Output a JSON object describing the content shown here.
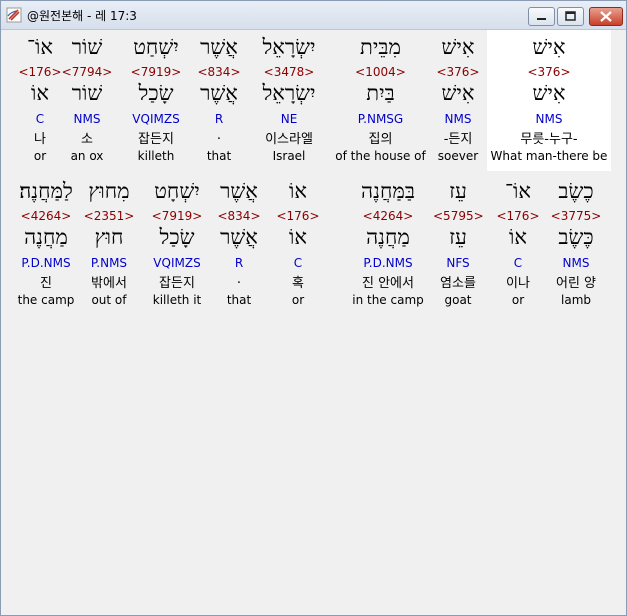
{
  "window": {
    "title": "@원전본해 - 레 17:3",
    "app_icon": "scroll-icon",
    "controls": [
      "minimize-icon",
      "maximize-icon",
      "close-icon"
    ]
  },
  "rows": [
    {
      "words": [
        {
          "heb": "אוֹ־",
          "code": "<176>",
          "lemma": "אוֹ",
          "morph": "C",
          "kor": "나",
          "eng": "or"
        },
        {
          "heb": "שׁוֹר",
          "code": "<7794>",
          "lemma": "שׁוֹר",
          "morph": "NMS",
          "kor": "소",
          "eng": "an ox"
        },
        {
          "heb": "יִשְׁחַט",
          "code": "<7919>",
          "lemma": "שָׂכַל",
          "morph": "VQIMZS",
          "kor": "잡든지",
          "eng": "killeth"
        },
        {
          "heb": "אֲשֶׁר",
          "code": "<834>",
          "lemma": "אֲשֶׁר",
          "morph": "R",
          "kor": ".",
          "eng": "that"
        },
        {
          "heb": "יִשְׂרָאֵל",
          "code": "<3478>",
          "lemma": "יִשְׂרָאֵל",
          "morph": "NE",
          "kor": "이스라엘",
          "eng": "Israel"
        },
        {
          "heb": "מִבֵּית",
          "code": "<1004>",
          "lemma": "בַּיִת",
          "morph": "P.NMSG",
          "kor": "집의",
          "eng": "of the house of"
        },
        {
          "heb": "אִישׁ",
          "code": "<376>",
          "lemma": "אִישׁ",
          "morph": "NMS",
          "kor": "-든지",
          "eng": "soever"
        },
        {
          "heb": "אִישׁ",
          "code": "<376>",
          "lemma": "אִישׁ",
          "morph": "NMS",
          "kor": "무릇-누구-",
          "eng": "What man-there be"
        }
      ]
    },
    {
      "words": [
        {
          "heb": "לַמַּחֲנֶה׃",
          "code": "<4264>",
          "lemma": "מַחֲנֶה",
          "morph": "P.D.NMS",
          "kor": "진",
          "eng": "the camp"
        },
        {
          "heb": "מִחוּץ",
          "code": "<2351>",
          "lemma": "חוּץ",
          "morph": "P.NMS",
          "kor": "밖에서",
          "eng": "out of"
        },
        {
          "heb": "יִשְׁחָט",
          "code": "<7919>",
          "lemma": "שָׂכַל",
          "morph": "VQIMZS",
          "kor": "잡든지",
          "eng": "killeth it"
        },
        {
          "heb": "אֲשֶׁר",
          "code": "<834>",
          "lemma": "אֲשֶׁר",
          "morph": "R",
          "kor": ".",
          "eng": "that"
        },
        {
          "heb": "אוֹ",
          "code": "<176>",
          "lemma": "אוֹ",
          "morph": "C",
          "kor": "혹",
          "eng": "or"
        },
        {
          "heb": "בַּמַּחֲנֶה",
          "code": "<4264>",
          "lemma": "מַחֲנֶה",
          "morph": "P.D.NMS",
          "kor": "진 안에서",
          "eng": "in the camp"
        },
        {
          "heb": "עֵז",
          "code": "<5795>",
          "lemma": "עֵז",
          "morph": "NFS",
          "kor": "염소를",
          "eng": "goat"
        },
        {
          "heb": "אוֹ־",
          "code": "<176>",
          "lemma": "אוֹ",
          "morph": "C",
          "kor": "이나",
          "eng": "or"
        },
        {
          "heb": "כֶשֶׂב",
          "code": "<3775>",
          "lemma": "כֶּשֶׂב",
          "morph": "NMS",
          "kor": "어린 양",
          "eng": "lamb"
        }
      ]
    }
  ],
  "colors": {
    "strong_code": "#8b0000",
    "morphology": "#0000cc",
    "text": "#000000",
    "selected_bg": "#ffffff",
    "client_bg": "#f0f0f0"
  }
}
